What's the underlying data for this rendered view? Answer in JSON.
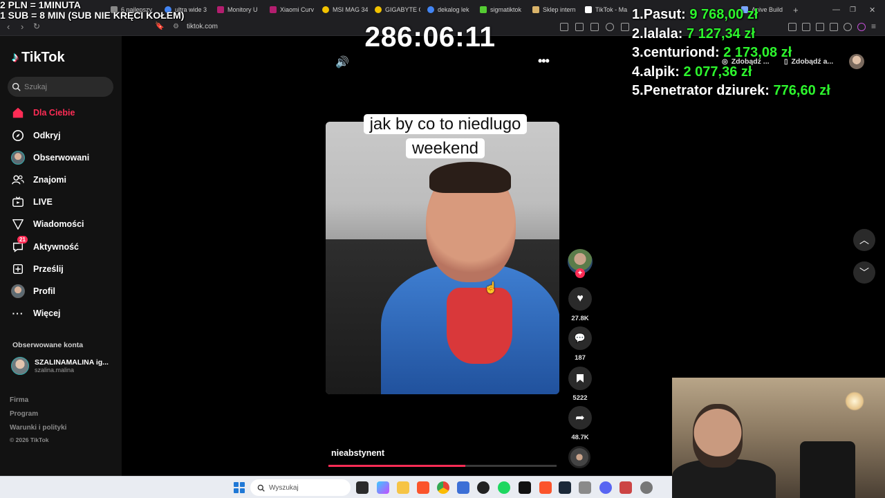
{
  "overlay": {
    "line1": "2 PLN = 1MINUTA",
    "line2": "1 SUB = 8 MIN (SUB NIE KRĘCI KOŁEM)",
    "timer": "286:06:11"
  },
  "leaderboard": [
    {
      "rank": "1.",
      "name": "Pasut:",
      "amount": "9 768,00 zł"
    },
    {
      "rank": "2.",
      "name": "lalala:",
      "amount": "7 127,34 zł"
    },
    {
      "rank": "3.",
      "name": "centuriond:",
      "amount": "2 173,08 zł"
    },
    {
      "rank": "4.",
      "name": "alpik:",
      "amount": "2 077,36 zł"
    },
    {
      "rank": "5.",
      "name": "Penetrator dziurek:",
      "amount": "776,60 zł"
    }
  ],
  "browser": {
    "tabs": [
      {
        "label": "6 najlepszy",
        "color": "#888888"
      },
      {
        "label": "ultra wide 3",
        "color": "#4285f4"
      },
      {
        "label": "Monitory U",
        "color": "#b31e6f"
      },
      {
        "label": "Xiaomi Curv",
        "color": "#b31e6f"
      },
      {
        "label": "MSI MAG 34",
        "color": "#f2c200"
      },
      {
        "label": "GIGABYTE G",
        "color": "#f2c200"
      },
      {
        "label": "dekalog lek",
        "color": "#4285f4"
      },
      {
        "label": "sigmatiktok",
        "color": "#55cc33"
      },
      {
        "label": "Sklep intern",
        "color": "#d9b36a"
      },
      {
        "label": "TikTok - Ma",
        "color": "#ffffff"
      },
      {
        "label": "Anive Build",
        "color": "#7aa7ff"
      }
    ],
    "url": "tiktok.com"
  },
  "tiktok": {
    "logo": "TikTok",
    "search_placeholder": "Szukaj",
    "nav": [
      {
        "label": "Dla Ciebie",
        "icon": "home-icon",
        "active": true
      },
      {
        "label": "Odkryj",
        "icon": "compass-icon"
      },
      {
        "label": "Obserwowani",
        "icon": "avatar-icon"
      },
      {
        "label": "Znajomi",
        "icon": "friends-icon"
      },
      {
        "label": "LIVE",
        "icon": "live-icon"
      },
      {
        "label": "Wiadomości",
        "icon": "messages-icon"
      },
      {
        "label": "Aktywność",
        "icon": "activity-icon",
        "badge": "21"
      },
      {
        "label": "Prześlij",
        "icon": "upload-icon"
      },
      {
        "label": "Profil",
        "icon": "profile-icon"
      },
      {
        "label": "Więcej",
        "icon": "more-icon"
      }
    ],
    "followed_title": "Obserwowane konta",
    "followed_account": {
      "name": "SZALINAMALINA ig...",
      "handle": "szalina.malina"
    },
    "footer": [
      "Firma",
      "Program",
      "Warunki i polityki"
    ],
    "copyright": "© 2026 TikTok",
    "top_pills": [
      "Zdobądź ...",
      "Zdobądź a..."
    ]
  },
  "video": {
    "caption_line1": "jak by co to niedlugo",
    "caption_line2": "weekend",
    "author": "nieabstynent",
    "progress": 0.6,
    "likes": "27.8K",
    "comments": "187",
    "saves": "5222",
    "shares": "48.7K"
  },
  "taskbar": {
    "search_placeholder": "Wyszukaj"
  }
}
